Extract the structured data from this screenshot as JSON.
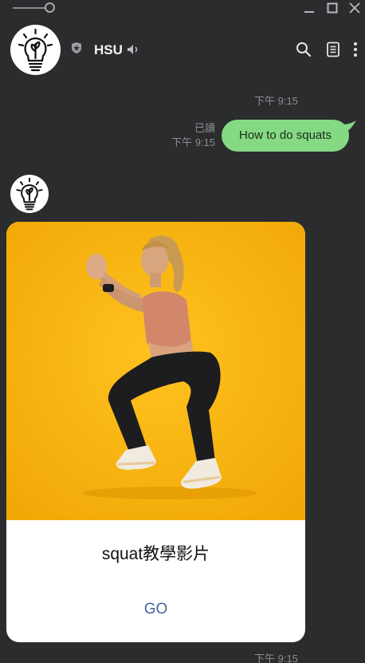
{
  "header": {
    "chat_name": "HSU"
  },
  "messages": {
    "top_timestamp": "下午 9:15",
    "sent": {
      "read_status": "已讀",
      "time": "下午 9:15",
      "text": "How to do squats"
    },
    "card": {
      "title": "squat教學影片",
      "button_label": "GO",
      "time": "下午 9:15"
    }
  },
  "icons": {
    "zoom": "zoom-slider",
    "minimize": "minimize-icon",
    "maximize": "maximize-icon",
    "close": "close-icon",
    "avatar": "lightbulb-logo",
    "official": "shield-star-icon",
    "mute": "speaker-icon",
    "search": "search-icon",
    "notes": "notes-icon",
    "more": "more-vertical-icon"
  },
  "colors": {
    "background": "#2b2c2e",
    "bubble": "#84d982",
    "link": "#47659a",
    "hero_background": "#f7b311"
  }
}
